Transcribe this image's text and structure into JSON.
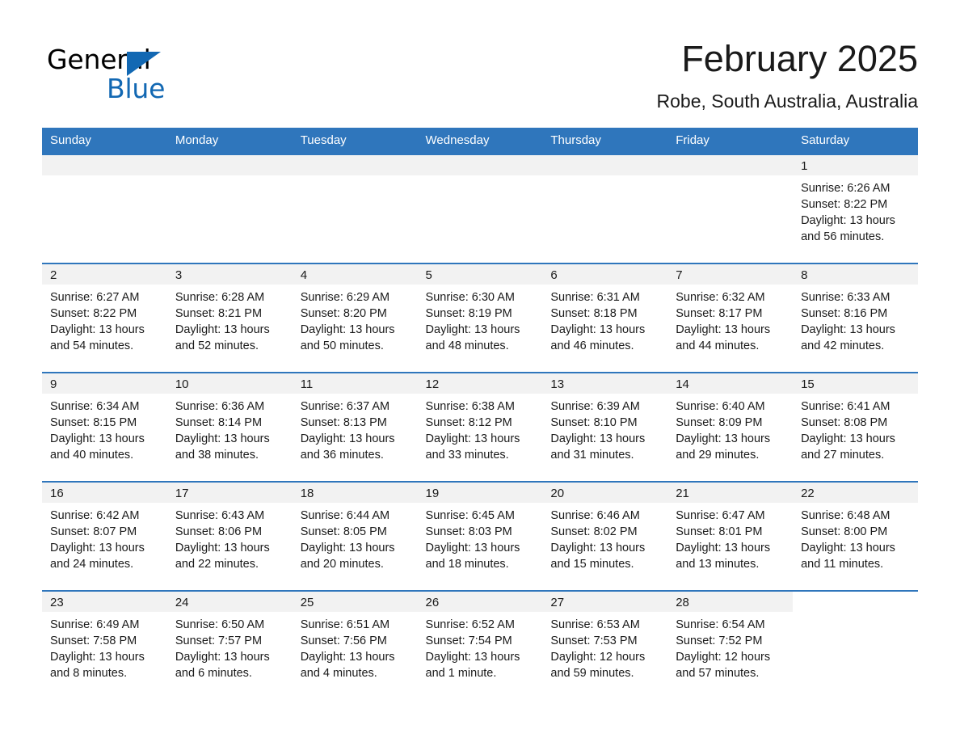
{
  "logo": {
    "word_one": "General",
    "word_two": "Blue",
    "triangle_color": "#1268b3",
    "blue_text_color": "#1268b3",
    "general_text_color": "#000000"
  },
  "header": {
    "title": "February 2025",
    "location": "Robe, South Australia, Australia"
  },
  "theme": {
    "header_blue": "#2f76bc",
    "day_band_gray": "#f2f2f2",
    "text_color": "#1a1a1a",
    "cell_background": "#ffffff"
  },
  "calendar": {
    "weekday_headers": [
      "Sunday",
      "Monday",
      "Tuesday",
      "Wednesday",
      "Thursday",
      "Friday",
      "Saturday"
    ],
    "weeks": [
      [
        {
          "day": "",
          "empty": true
        },
        {
          "day": "",
          "empty": true
        },
        {
          "day": "",
          "empty": true
        },
        {
          "day": "",
          "empty": true
        },
        {
          "day": "",
          "empty": true
        },
        {
          "day": "",
          "empty": true
        },
        {
          "day": "1",
          "empty": false,
          "sunrise": "Sunrise: 6:26 AM",
          "sunset": "Sunset: 8:22 PM",
          "daylight_line1": "Daylight: 13 hours",
          "daylight_line2": "and 56 minutes."
        }
      ],
      [
        {
          "day": "2",
          "empty": false,
          "sunrise": "Sunrise: 6:27 AM",
          "sunset": "Sunset: 8:22 PM",
          "daylight_line1": "Daylight: 13 hours",
          "daylight_line2": "and 54 minutes."
        },
        {
          "day": "3",
          "empty": false,
          "sunrise": "Sunrise: 6:28 AM",
          "sunset": "Sunset: 8:21 PM",
          "daylight_line1": "Daylight: 13 hours",
          "daylight_line2": "and 52 minutes."
        },
        {
          "day": "4",
          "empty": false,
          "sunrise": "Sunrise: 6:29 AM",
          "sunset": "Sunset: 8:20 PM",
          "daylight_line1": "Daylight: 13 hours",
          "daylight_line2": "and 50 minutes."
        },
        {
          "day": "5",
          "empty": false,
          "sunrise": "Sunrise: 6:30 AM",
          "sunset": "Sunset: 8:19 PM",
          "daylight_line1": "Daylight: 13 hours",
          "daylight_line2": "and 48 minutes."
        },
        {
          "day": "6",
          "empty": false,
          "sunrise": "Sunrise: 6:31 AM",
          "sunset": "Sunset: 8:18 PM",
          "daylight_line1": "Daylight: 13 hours",
          "daylight_line2": "and 46 minutes."
        },
        {
          "day": "7",
          "empty": false,
          "sunrise": "Sunrise: 6:32 AM",
          "sunset": "Sunset: 8:17 PM",
          "daylight_line1": "Daylight: 13 hours",
          "daylight_line2": "and 44 minutes."
        },
        {
          "day": "8",
          "empty": false,
          "sunrise": "Sunrise: 6:33 AM",
          "sunset": "Sunset: 8:16 PM",
          "daylight_line1": "Daylight: 13 hours",
          "daylight_line2": "and 42 minutes."
        }
      ],
      [
        {
          "day": "9",
          "empty": false,
          "sunrise": "Sunrise: 6:34 AM",
          "sunset": "Sunset: 8:15 PM",
          "daylight_line1": "Daylight: 13 hours",
          "daylight_line2": "and 40 minutes."
        },
        {
          "day": "10",
          "empty": false,
          "sunrise": "Sunrise: 6:36 AM",
          "sunset": "Sunset: 8:14 PM",
          "daylight_line1": "Daylight: 13 hours",
          "daylight_line2": "and 38 minutes."
        },
        {
          "day": "11",
          "empty": false,
          "sunrise": "Sunrise: 6:37 AM",
          "sunset": "Sunset: 8:13 PM",
          "daylight_line1": "Daylight: 13 hours",
          "daylight_line2": "and 36 minutes."
        },
        {
          "day": "12",
          "empty": false,
          "sunrise": "Sunrise: 6:38 AM",
          "sunset": "Sunset: 8:12 PM",
          "daylight_line1": "Daylight: 13 hours",
          "daylight_line2": "and 33 minutes."
        },
        {
          "day": "13",
          "empty": false,
          "sunrise": "Sunrise: 6:39 AM",
          "sunset": "Sunset: 8:10 PM",
          "daylight_line1": "Daylight: 13 hours",
          "daylight_line2": "and 31 minutes."
        },
        {
          "day": "14",
          "empty": false,
          "sunrise": "Sunrise: 6:40 AM",
          "sunset": "Sunset: 8:09 PM",
          "daylight_line1": "Daylight: 13 hours",
          "daylight_line2": "and 29 minutes."
        },
        {
          "day": "15",
          "empty": false,
          "sunrise": "Sunrise: 6:41 AM",
          "sunset": "Sunset: 8:08 PM",
          "daylight_line1": "Daylight: 13 hours",
          "daylight_line2": "and 27 minutes."
        }
      ],
      [
        {
          "day": "16",
          "empty": false,
          "sunrise": "Sunrise: 6:42 AM",
          "sunset": "Sunset: 8:07 PM",
          "daylight_line1": "Daylight: 13 hours",
          "daylight_line2": "and 24 minutes."
        },
        {
          "day": "17",
          "empty": false,
          "sunrise": "Sunrise: 6:43 AM",
          "sunset": "Sunset: 8:06 PM",
          "daylight_line1": "Daylight: 13 hours",
          "daylight_line2": "and 22 minutes."
        },
        {
          "day": "18",
          "empty": false,
          "sunrise": "Sunrise: 6:44 AM",
          "sunset": "Sunset: 8:05 PM",
          "daylight_line1": "Daylight: 13 hours",
          "daylight_line2": "and 20 minutes."
        },
        {
          "day": "19",
          "empty": false,
          "sunrise": "Sunrise: 6:45 AM",
          "sunset": "Sunset: 8:03 PM",
          "daylight_line1": "Daylight: 13 hours",
          "daylight_line2": "and 18 minutes."
        },
        {
          "day": "20",
          "empty": false,
          "sunrise": "Sunrise: 6:46 AM",
          "sunset": "Sunset: 8:02 PM",
          "daylight_line1": "Daylight: 13 hours",
          "daylight_line2": "and 15 minutes."
        },
        {
          "day": "21",
          "empty": false,
          "sunrise": "Sunrise: 6:47 AM",
          "sunset": "Sunset: 8:01 PM",
          "daylight_line1": "Daylight: 13 hours",
          "daylight_line2": "and 13 minutes."
        },
        {
          "day": "22",
          "empty": false,
          "sunrise": "Sunrise: 6:48 AM",
          "sunset": "Sunset: 8:00 PM",
          "daylight_line1": "Daylight: 13 hours",
          "daylight_line2": "and 11 minutes."
        }
      ],
      [
        {
          "day": "23",
          "empty": false,
          "sunrise": "Sunrise: 6:49 AM",
          "sunset": "Sunset: 7:58 PM",
          "daylight_line1": "Daylight: 13 hours",
          "daylight_line2": "and 8 minutes."
        },
        {
          "day": "24",
          "empty": false,
          "sunrise": "Sunrise: 6:50 AM",
          "sunset": "Sunset: 7:57 PM",
          "daylight_line1": "Daylight: 13 hours",
          "daylight_line2": "and 6 minutes."
        },
        {
          "day": "25",
          "empty": false,
          "sunrise": "Sunrise: 6:51 AM",
          "sunset": "Sunset: 7:56 PM",
          "daylight_line1": "Daylight: 13 hours",
          "daylight_line2": "and 4 minutes."
        },
        {
          "day": "26",
          "empty": false,
          "sunrise": "Sunrise: 6:52 AM",
          "sunset": "Sunset: 7:54 PM",
          "daylight_line1": "Daylight: 13 hours",
          "daylight_line2": "and 1 minute."
        },
        {
          "day": "27",
          "empty": false,
          "sunrise": "Sunrise: 6:53 AM",
          "sunset": "Sunset: 7:53 PM",
          "daylight_line1": "Daylight: 12 hours",
          "daylight_line2": "and 59 minutes."
        },
        {
          "day": "28",
          "empty": false,
          "sunrise": "Sunrise: 6:54 AM",
          "sunset": "Sunset: 7:52 PM",
          "daylight_line1": "Daylight: 12 hours",
          "daylight_line2": "and 57 minutes."
        },
        {
          "day": "",
          "empty": true,
          "blank_tail": true
        }
      ]
    ]
  }
}
